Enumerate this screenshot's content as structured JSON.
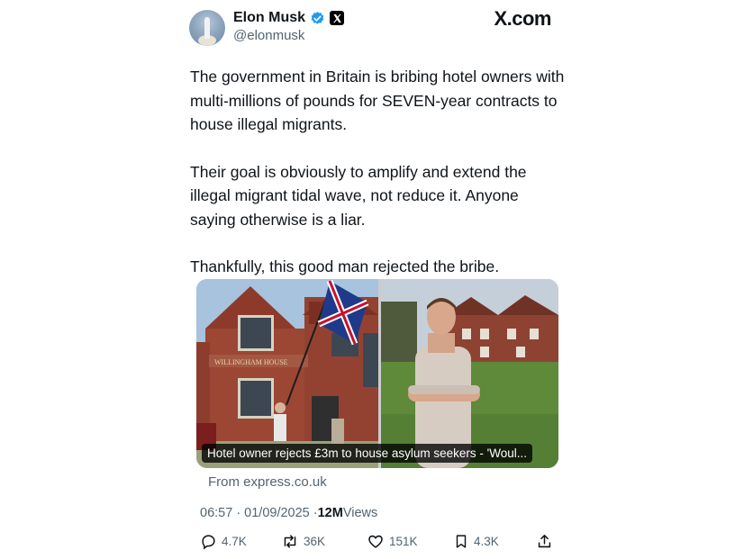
{
  "header": {
    "author_name": "Elon Musk",
    "handle": "@elonmusk",
    "site_logo": "X.com",
    "verified_badge_color": "#1d9bf0"
  },
  "tweet": {
    "paragraphs": [
      "The government in Britain is bribing hotel owners with multi-millions of pounds for SEVEN-year contracts to house illegal migrants.",
      "Their goal is obviously to amplify and extend the illegal migrant tidal wave, not reduce it. Anyone saying otherwise is a liar.",
      "Thankfully, this good man rejected the bribe."
    ]
  },
  "card": {
    "title": "Hotel owner rejects £3m to house asylum seekers - 'Woul...",
    "sign_text": "WILLINGHAM HOUSE",
    "source": "From express.co.uk"
  },
  "meta": {
    "timestamp": "06:57 · 01/09/2025 · ",
    "views_count": "12M",
    "views_label": " Views"
  },
  "actions": {
    "replies": "4.7K",
    "reposts": "36K",
    "likes": "151K",
    "bookmarks": "4.3K"
  },
  "icons": [
    "verified-badge-icon",
    "x-logo-icon",
    "reply-icon",
    "repost-icon",
    "like-icon",
    "bookmark-icon",
    "share-icon"
  ]
}
